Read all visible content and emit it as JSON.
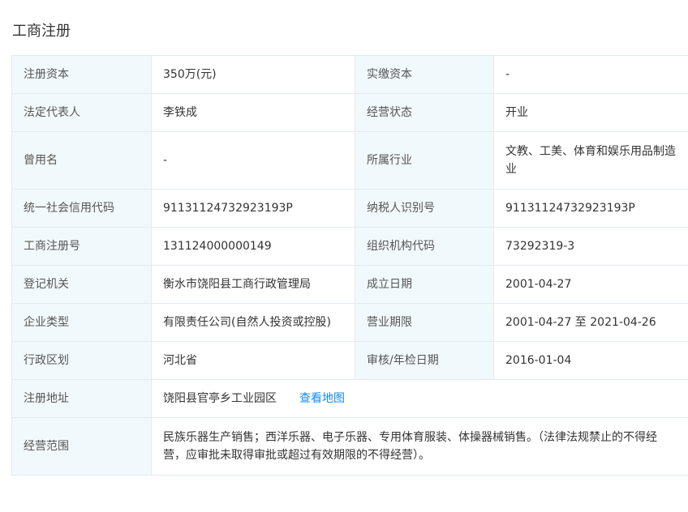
{
  "section": {
    "title": "工商注册"
  },
  "rows": [
    {
      "l1": "注册资本",
      "v1": "350万(元)",
      "l2": "实缴资本",
      "v2": "-"
    },
    {
      "l1": "法定代表人",
      "v1": "李铁成",
      "l2": "经营状态",
      "v2": "开业"
    },
    {
      "l1": "曾用名",
      "v1": "-",
      "l2": "所属行业",
      "v2": "文教、工美、体育和娱乐用品制造业"
    },
    {
      "l1": "统一社会信用代码",
      "v1": "91131124732923193P",
      "l2": "纳税人识别号",
      "v2": "91131124732923193P"
    },
    {
      "l1": "工商注册号",
      "v1": "131124000000149",
      "l2": "组织机构代码",
      "v2": "73292319-3"
    },
    {
      "l1": "登记机关",
      "v1": "衡水市饶阳县工商行政管理局",
      "l2": "成立日期",
      "v2": "2001-04-27"
    },
    {
      "l1": "企业类型",
      "v1": "有限责任公司(自然人投资或控股)",
      "l2": "营业期限",
      "v2": "2001-04-27 至 2021-04-26"
    },
    {
      "l1": "行政区划",
      "v1": "河北省",
      "l2": "审核/年检日期",
      "v2": "2016-01-04"
    }
  ],
  "address": {
    "label": "注册地址",
    "value": "饶阳县官亭乡工业园区",
    "map_link": "查看地图"
  },
  "scope": {
    "label": "经营范围",
    "value": "民族乐器生产销售；西洋乐器、电子乐器、专用体育服装、体操器械销售。（法律法规禁止的不得经营，应审批未取得审批或超过有效期限的不得经营）。"
  }
}
